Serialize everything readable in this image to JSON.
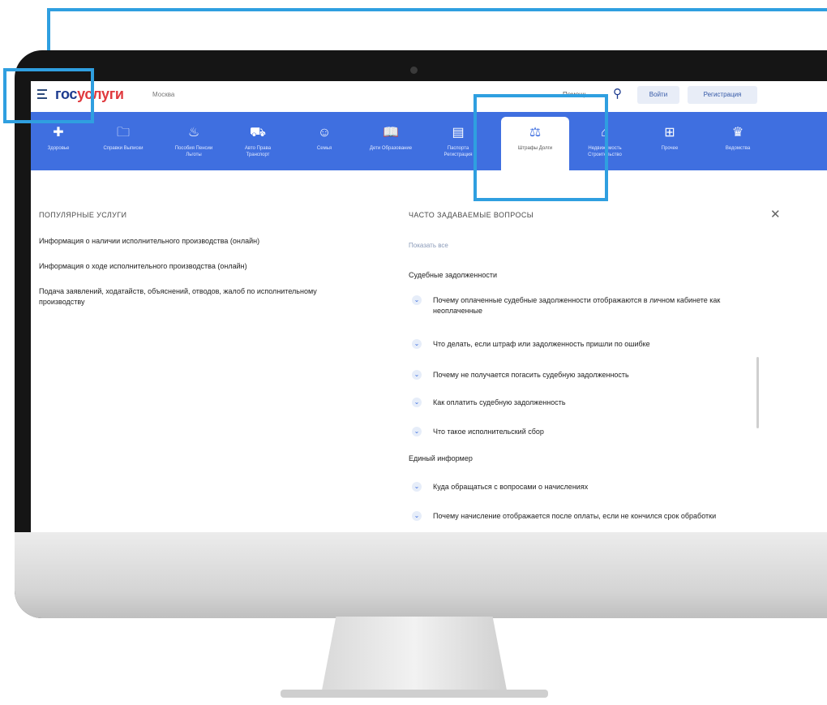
{
  "colors": {
    "accent": "#3f6fe0",
    "callout": "#2f9fe0",
    "logo_blue": "#1d3b8f",
    "logo_red": "#e0393e"
  },
  "header": {
    "logo_part1": "гос",
    "logo_part2": "услуги",
    "city": "Москва",
    "search_label": "Помощь",
    "login_label": "Войти",
    "register_label": "Регистрация"
  },
  "nav": [
    {
      "icon": "health-icon",
      "glyph": "✚",
      "label": "Здоровье"
    },
    {
      "icon": "folder-icon",
      "glyph": "🗀",
      "label": "Справки Выписки"
    },
    {
      "icon": "benefits-icon",
      "glyph": "♨",
      "label": "Пособия Пенсии Льготы"
    },
    {
      "icon": "car-icon",
      "glyph": "⛟",
      "label": "Авто Права Транспорт"
    },
    {
      "icon": "family-icon",
      "glyph": "☺",
      "label": "Семья"
    },
    {
      "icon": "book-icon",
      "glyph": "📖",
      "label": "Дети Образование"
    },
    {
      "icon": "passport-icon",
      "glyph": "▤",
      "label": "Паспорта Регистрация"
    },
    {
      "icon": "gavel-icon",
      "glyph": "⚖",
      "label": "Штрафы Долги"
    },
    {
      "icon": "house-icon",
      "glyph": "⌂",
      "label": "Недвижимость Строительство"
    },
    {
      "icon": "grid-icon",
      "glyph": "⊞",
      "label": "Прочее"
    },
    {
      "icon": "emblem-icon",
      "glyph": "♛",
      "label": "Ведомства"
    }
  ],
  "popular": {
    "title": "ПОПУЛЯРНЫЕ УСЛУГИ",
    "items": [
      "Информация о наличии исполнительного производства (онлайн)",
      "Информация о ходе исполнительного производства (онлайн)",
      "Подача заявлений, ходатайств, объяснений, отводов, жалоб по исполнительному производству"
    ]
  },
  "faq": {
    "title": "ЧАСТО ЗАДАВАЕМЫЕ ВОПРОСЫ",
    "show_all": "Показать все",
    "group1": "Судебные задолженности",
    "items1": [
      "Почему оплаченные судебные задолженности отображаются в личном кабинете как неоплаченные",
      "Что делать, если штраф или задолженность пришли по ошибке",
      "Почему не получается погасить судебную задолженность",
      "Как оплатить судебную задолженность",
      "Что такое исполнительский сбор"
    ],
    "group2": "Единый информер",
    "items2": [
      "Куда обращаться с вопросами о начислениях",
      "Почему начисление отображается после оплаты, если не кончился срок обработки"
    ]
  }
}
